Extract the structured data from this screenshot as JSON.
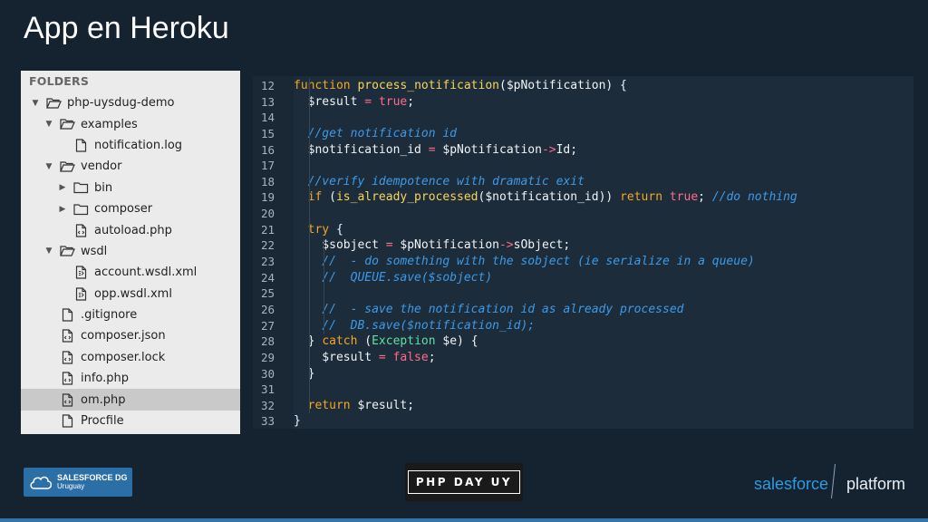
{
  "slide": {
    "title": "App en Heroku"
  },
  "sidebar": {
    "header": "FOLDERS",
    "items": [
      {
        "label": "php-uysdug-demo",
        "kind": "folder",
        "expanded": true,
        "depth": 0,
        "icon": "folder-open-icon"
      },
      {
        "label": "examples",
        "kind": "folder",
        "expanded": true,
        "depth": 1,
        "icon": "folder-open-icon"
      },
      {
        "label": "notification.log",
        "kind": "file",
        "depth": 2,
        "icon": "file-icon"
      },
      {
        "label": "vendor",
        "kind": "folder",
        "expanded": true,
        "depth": 1,
        "icon": "folder-open-icon"
      },
      {
        "label": "bin",
        "kind": "folder",
        "expanded": false,
        "depth": 2,
        "icon": "folder-icon"
      },
      {
        "label": "composer",
        "kind": "folder",
        "expanded": false,
        "depth": 2,
        "icon": "folder-icon"
      },
      {
        "label": "autoload.php",
        "kind": "file",
        "depth": 2,
        "icon": "code-file-icon"
      },
      {
        "label": "wsdl",
        "kind": "folder",
        "expanded": true,
        "depth": 1,
        "icon": "folder-open-icon"
      },
      {
        "label": "account.wsdl.xml",
        "kind": "file",
        "depth": 2,
        "icon": "xml-file-icon"
      },
      {
        "label": "opp.wsdl.xml",
        "kind": "file",
        "depth": 2,
        "icon": "xml-file-icon"
      },
      {
        "label": ".gitignore",
        "kind": "file",
        "depth": 1,
        "icon": "file-icon"
      },
      {
        "label": "composer.json",
        "kind": "file",
        "depth": 1,
        "icon": "code-file-icon"
      },
      {
        "label": "composer.lock",
        "kind": "file",
        "depth": 1,
        "icon": "code-file-icon"
      },
      {
        "label": "info.php",
        "kind": "file",
        "depth": 1,
        "icon": "code-file-icon"
      },
      {
        "label": "om.php",
        "kind": "file",
        "depth": 1,
        "icon": "code-file-icon",
        "selected": true
      },
      {
        "label": "Procfile",
        "kind": "file",
        "depth": 1,
        "icon": "file-icon"
      }
    ]
  },
  "editor": {
    "line_numbers": [
      "12",
      "13",
      "14",
      "15",
      "16",
      "17",
      "18",
      "19",
      "20",
      "21",
      "22",
      "23",
      "24",
      "25",
      "26",
      "27",
      "28",
      "29",
      "30",
      "31",
      "32",
      "33"
    ],
    "lines": [
      [
        [
          "kw",
          "function "
        ],
        [
          "fn",
          "process_notification"
        ],
        [
          "var",
          "($pNotification) {"
        ]
      ],
      [
        [
          "var",
          "  $result "
        ],
        [
          "op",
          "= "
        ],
        [
          "bool",
          "true"
        ],
        [
          "var",
          ";"
        ]
      ],
      [],
      [
        [
          "cm",
          "  //get notification id"
        ]
      ],
      [
        [
          "var",
          "  $notification_id "
        ],
        [
          "op",
          "= "
        ],
        [
          "var",
          "$pNotification"
        ],
        [
          "op",
          "->"
        ],
        [
          "var",
          "Id;"
        ]
      ],
      [],
      [
        [
          "cm",
          "  //verify idempotence with dramatic exit"
        ]
      ],
      [
        [
          "kw",
          "  if "
        ],
        [
          "var",
          "("
        ],
        [
          "fn",
          "is_already_processed"
        ],
        [
          "var",
          "($notification_id)) "
        ],
        [
          "kw",
          "return "
        ],
        [
          "bool",
          "true"
        ],
        [
          "var",
          "; "
        ],
        [
          "cm",
          "//do nothing"
        ]
      ],
      [],
      [
        [
          "kw",
          "  try "
        ],
        [
          "var",
          "{"
        ]
      ],
      [
        [
          "var",
          "    $sobject "
        ],
        [
          "op",
          "= "
        ],
        [
          "var",
          "$pNotification"
        ],
        [
          "op",
          "->"
        ],
        [
          "var",
          "sObject;"
        ]
      ],
      [
        [
          "cm",
          "    //  - do something with the sobject (ie serialize in a queue)"
        ]
      ],
      [
        [
          "cm",
          "    //  QUEUE.save($sobject)"
        ]
      ],
      [],
      [
        [
          "cm",
          "    //  - save the notification id as already processed"
        ]
      ],
      [
        [
          "cm",
          "    //  DB.save($notification_id);"
        ]
      ],
      [
        [
          "var",
          "  } "
        ],
        [
          "kw",
          "catch "
        ],
        [
          "var",
          "("
        ],
        [
          "cls",
          "Exception "
        ],
        [
          "var",
          "$e) {"
        ]
      ],
      [
        [
          "var",
          "    $result "
        ],
        [
          "op",
          "= "
        ],
        [
          "bool",
          "false"
        ],
        [
          "var",
          ";"
        ]
      ],
      [
        [
          "var",
          "  }"
        ]
      ],
      [],
      [
        [
          "kw",
          "  return "
        ],
        [
          "var",
          "$result;"
        ]
      ],
      [
        [
          "var",
          "}"
        ]
      ]
    ]
  },
  "footer": {
    "group_badge": {
      "line1": "SALESFORCE DG",
      "line2": "Uruguay"
    },
    "event_logo": "PHP DAY UY",
    "brand_left": "salesforce",
    "brand_right": "platform"
  },
  "colors": {
    "background": "#152230",
    "editor_bg": "#1d2c3a",
    "keyword": "#f5a623",
    "function": "#f6d55c",
    "comment": "#3d9ae8",
    "boolean": "#ff6b8a",
    "salesforce_blue": "#2f9be0"
  }
}
